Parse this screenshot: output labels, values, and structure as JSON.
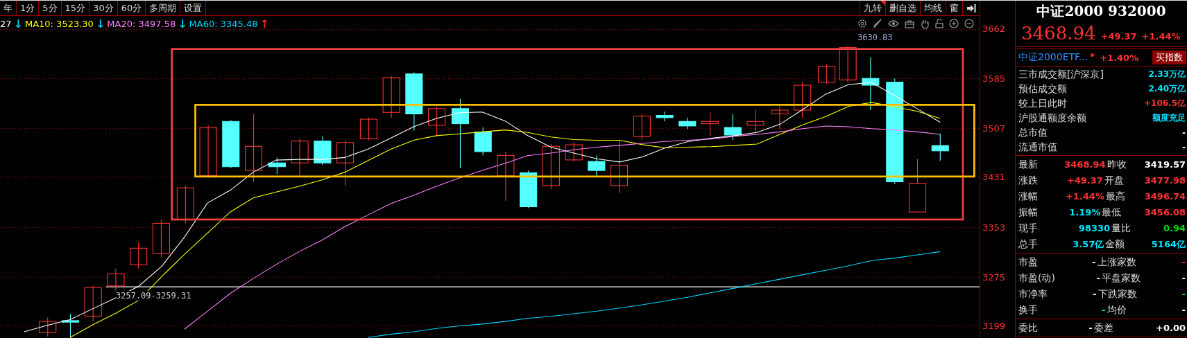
{
  "toolbar": {
    "periods": [
      {
        "label": "年"
      },
      {
        "label": "1分"
      },
      {
        "label": "5分"
      },
      {
        "label": "15分"
      },
      {
        "label": "30分"
      },
      {
        "label": "60分"
      },
      {
        "label": "多周期"
      },
      {
        "label": "设置"
      }
    ],
    "right_tools": [
      {
        "label": "九转",
        "flag": true
      },
      {
        "label": "删自选",
        "flag": false
      },
      {
        "label": "均线",
        "flag": false
      },
      {
        "label": "窗",
        "flag": false
      }
    ]
  },
  "ma_legend": [
    {
      "text": "27",
      "color": "#ffffff"
    },
    {
      "text": "↓",
      "color": "#00c8f0"
    },
    {
      "text": "MA10: 3523.30",
      "color": "#ffff00"
    },
    {
      "text": "↓",
      "color": "#00c8f0"
    },
    {
      "text": "MA20: 3497.58",
      "color": "#ff80ff"
    },
    {
      "text": "↓",
      "color": "#00c8f0"
    },
    {
      "text": "MA60: 3345.48",
      "color": "#00d8ff"
    },
    {
      "text": "↑",
      "color": "#ff2020"
    }
  ],
  "chart": {
    "high_label": "3630.83",
    "range_label": "3257.09-3259.31",
    "chart_data": {
      "type": "line",
      "grid": true,
      "ylim": [
        3180.2,
        3706.8
      ],
      "yticks": [
        3662,
        3585,
        3507,
        3431,
        3353,
        3275,
        3199
      ],
      "ref_lines": [
        {
          "axis": "y",
          "value": 3260,
          "color": "#888888"
        }
      ],
      "series": [
        {
          "color": "#ffffff",
          "values": [
            3190,
            3200,
            3209,
            3226,
            3243,
            3261,
            3292,
            3338,
            3391,
            3411,
            3439,
            3458,
            3459,
            3459,
            3462,
            3475,
            3492,
            3510,
            3523,
            3532,
            3533,
            3519,
            3496,
            3478,
            3469,
            3460,
            3455,
            3463,
            3477,
            3487,
            3492,
            3496,
            3501,
            3514,
            3537,
            3561,
            3576,
            3579,
            3559,
            3538,
            3517
          ]
        },
        {
          "color": "#ffff00",
          "values": [
            null,
            null,
            3181,
            3201,
            3219,
            3239,
            3276,
            3311,
            3344,
            3377,
            3399,
            3408,
            3417,
            3427,
            3439,
            3457,
            3475,
            3489,
            3496,
            3499,
            3502,
            3505,
            3501,
            3494,
            3490,
            3489,
            3489,
            3482,
            3477,
            3478,
            3479,
            3481,
            3483,
            3498,
            3513,
            3526,
            3542,
            3548,
            3541,
            3534,
            3523
          ]
        },
        {
          "color": "#ff80ff",
          "values": [
            null,
            null,
            null,
            null,
            null,
            null,
            null,
            3194,
            3222,
            3250,
            3273,
            3295,
            3315,
            3333,
            3354,
            3372,
            3390,
            3403,
            3417,
            3430,
            3442,
            3453,
            3465,
            3469,
            3474,
            3478,
            3481,
            3484,
            3487,
            3489,
            3491,
            3495,
            3498,
            3502,
            3507,
            3511,
            3510,
            3507,
            3505,
            3502,
            3498
          ]
        },
        {
          "color": "#00d8ff",
          "values": [
            null,
            null,
            null,
            null,
            null,
            null,
            null,
            null,
            null,
            null,
            null,
            null,
            null,
            null,
            null,
            3181,
            3186,
            3190,
            3195,
            3199,
            3202,
            3206,
            3211,
            3214,
            3218,
            3222,
            3227,
            3232,
            3238,
            3244,
            3251,
            3258,
            3265,
            3272,
            3279,
            3286,
            3293,
            3301,
            3305,
            3310,
            3315
          ]
        }
      ]
    }
  },
  "quote_panel": {
    "title": "中证2000 932000",
    "price": "3468.94",
    "change": "+49.37",
    "change_pct": "+1.44%",
    "etf": {
      "name": "中证2000ETF...",
      "change_pct": "+1.40%",
      "button": "买指数"
    },
    "sections": [
      {
        "kind": "single",
        "rows": [
          [
            {
              "label": "三市成交额[沪深京]",
              "value": "2.33万亿",
              "color": "#00e5ff"
            }
          ],
          [
            {
              "label": "预估成交额",
              "value": "2.40万亿",
              "color": "#00e5ff"
            }
          ],
          [
            {
              "label": "较上日此时",
              "value": "+106.5亿",
              "color": "#ff3232"
            }
          ],
          [
            {
              "label": "沪股通额度余额",
              "value": "额度充足",
              "color": "#00e5ff"
            }
          ],
          [
            {
              "label": "总市值",
              "value": "-",
              "color": "#ffffff"
            }
          ],
          [
            {
              "label": "流通市值",
              "value": "-",
              "color": "#ffffff"
            }
          ]
        ]
      },
      {
        "kind": "double",
        "rows": [
          [
            {
              "label": "最新",
              "value": "3468.94",
              "color": "#ff3232"
            },
            {
              "label": "昨收",
              "value": "3419.57",
              "color": "#ffffff"
            }
          ],
          [
            {
              "label": "涨跌",
              "value": "+49.37",
              "color": "#ff3232"
            },
            {
              "label": "开盘",
              "value": "3477.98",
              "color": "#ff3232"
            }
          ],
          [
            {
              "label": "涨幅",
              "value": "+1.44%",
              "color": "#ff3232"
            },
            {
              "label": "最高",
              "value": "3496.74",
              "color": "#ff3232"
            }
          ],
          [
            {
              "label": "振幅",
              "value": "1.19%",
              "color": "#00e5ff"
            },
            {
              "label": "最低",
              "value": "3456.08",
              "color": "#ff3232"
            }
          ],
          [
            {
              "label": "现手",
              "value": "98330",
              "color": "#00e5ff"
            },
            {
              "label": "量比",
              "value": "0.94",
              "color": "#00e000"
            }
          ],
          [
            {
              "label": "总手",
              "value": "3.57亿",
              "color": "#00e5ff"
            },
            {
              "label": "金额",
              "value": "5164亿",
              "color": "#00e5ff"
            }
          ]
        ]
      },
      {
        "kind": "double",
        "rows": [
          [
            {
              "label": "市盈",
              "value": "-",
              "color": "#ffffff"
            },
            {
              "label": "上涨家数",
              "value": "-",
              "color": "#ff3232"
            }
          ],
          [
            {
              "label": "市盈(动)",
              "value": "-",
              "color": "#ffffff"
            },
            {
              "label": "平盘家数",
              "value": "-",
              "color": "#ffffff"
            }
          ],
          [
            {
              "label": "市净率",
              "value": "-",
              "color": "#ffffff"
            },
            {
              "label": "下跌家数",
              "value": "-",
              "color": "#00e000"
            }
          ],
          [
            {
              "label": "换手",
              "value": "-",
              "color": "#00e5ff"
            },
            {
              "label": "均价",
              "value": "-",
              "color": "#ffffff"
            }
          ]
        ]
      },
      {
        "kind": "double",
        "rows": [
          [
            {
              "label": "委比",
              "value": "-",
              "color": "#ffffff"
            },
            {
              "label": "委差",
              "value": "+0.00",
              "color": "#ffffff"
            }
          ]
        ]
      }
    ]
  }
}
